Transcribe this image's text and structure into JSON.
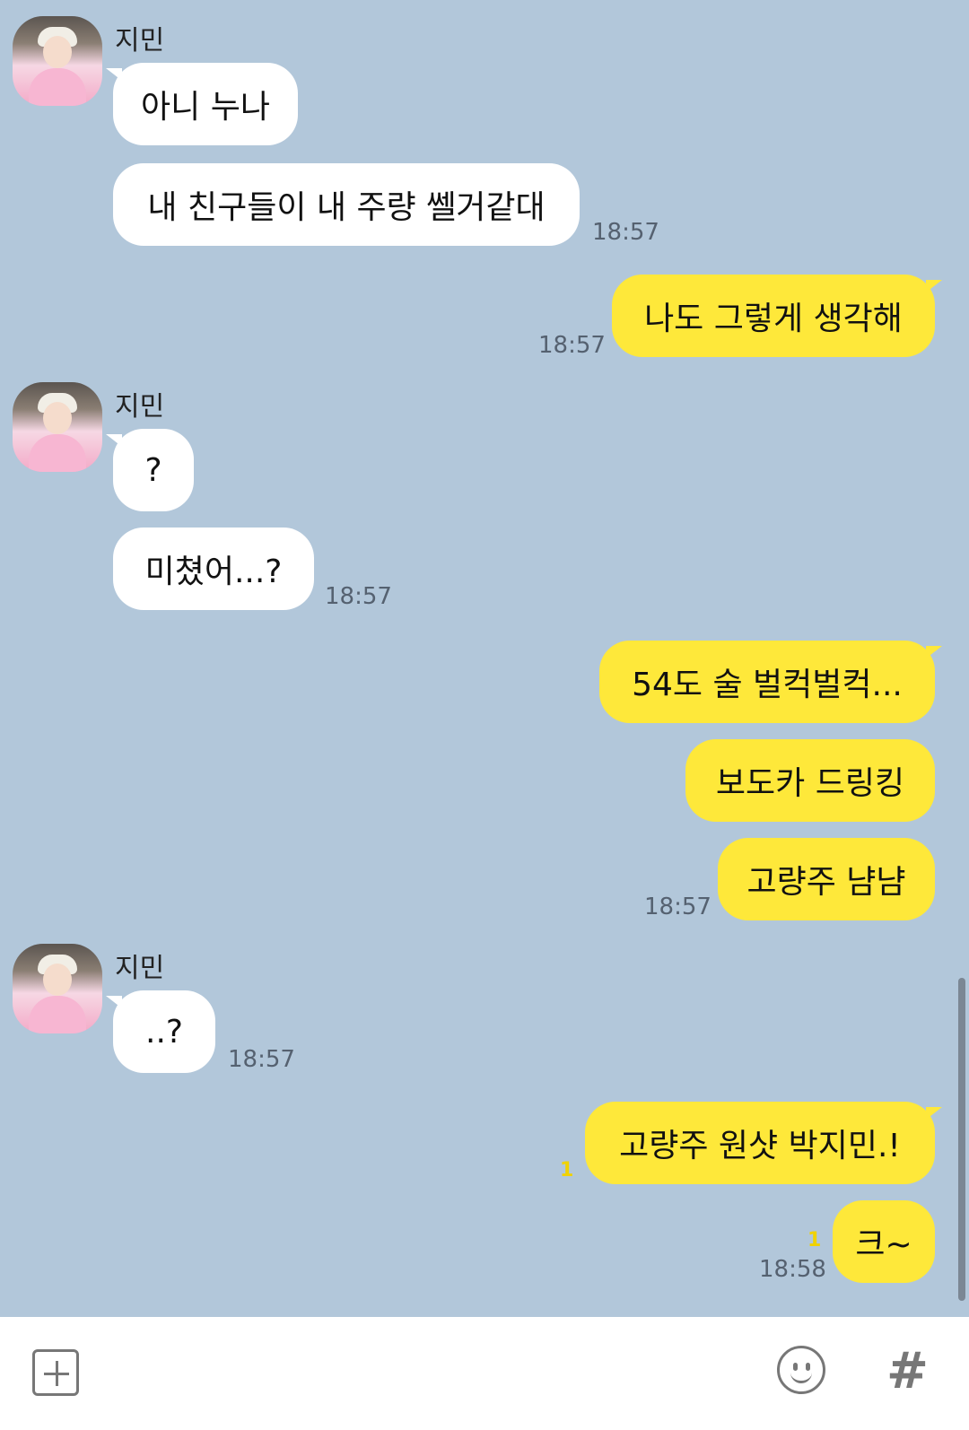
{
  "colors": {
    "background": "#b2c7da",
    "incoming_bubble": "#ffffff",
    "outgoing_bubble": "#fee83a",
    "unread": "#f0d200"
  },
  "messages": [
    {
      "sender": "지민",
      "text": "아니 누나"
    },
    {
      "text": "내 친구들이 내 주량 쎌거같대",
      "time": "18:57"
    },
    {
      "text": "나도 그렇게 생각해",
      "time": "18:57"
    },
    {
      "sender": "지민",
      "text": "?"
    },
    {
      "text": "미쳤어...?",
      "time": "18:57"
    },
    {
      "text": "54도 술 벌컥벌컥..."
    },
    {
      "text": "보도카 드링킹"
    },
    {
      "text": "고량주 냠냠",
      "time": "18:57"
    },
    {
      "sender": "지민",
      "text": "..?",
      "time": "18:57"
    },
    {
      "text": "고량주 원샷 박지민.!",
      "unread": "1"
    },
    {
      "text": "크~",
      "unread": "1",
      "time": "18:58"
    }
  ],
  "input_bar": {
    "left_icon": "plus-box-icon",
    "emoji_icon": "smiley-icon",
    "hash_icon": "#"
  }
}
